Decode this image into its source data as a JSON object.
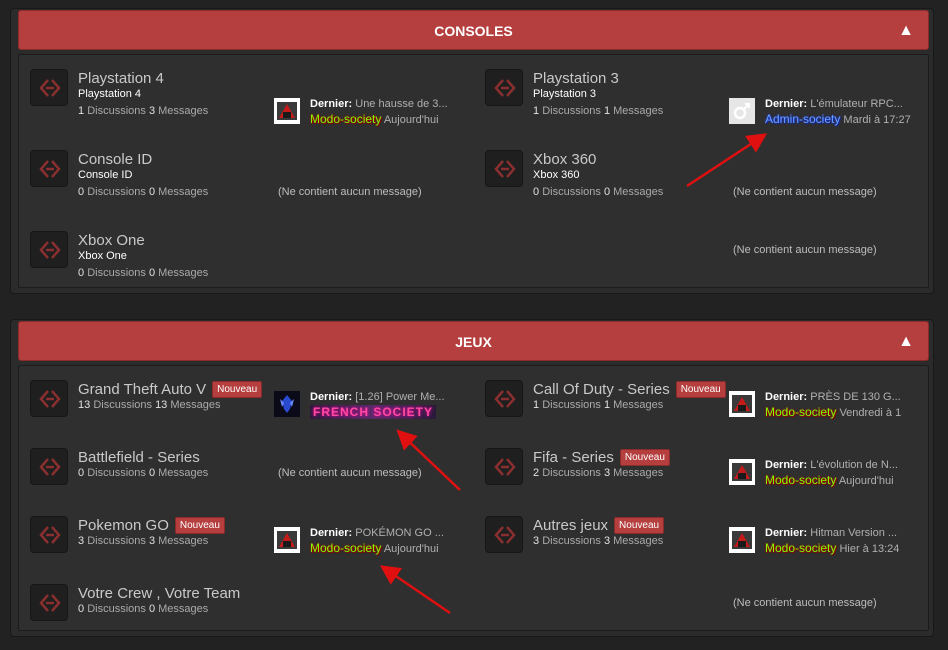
{
  "categories": [
    {
      "title": "CONSOLES",
      "forums": [
        {
          "title": "Playstation 4",
          "subtitle": "Playstation 4",
          "discussions": "1",
          "messages": "3",
          "last": {
            "label": "Dernier:",
            "text": "Une hausse de 3...",
            "user": "Modo-society",
            "date": "Aujourd'hui",
            "usertype": "modo"
          }
        },
        {
          "title": "Playstation 3",
          "subtitle": "Playstation 3",
          "discussions": "1",
          "messages": "1",
          "last": {
            "label": "Dernier:",
            "text": "L'émulateur RPC...",
            "user": "Admin-society",
            "date": "Mardi à 17:27",
            "usertype": "admin"
          }
        },
        {
          "title": "Console ID",
          "subtitle": "Console ID",
          "discussions": "0",
          "messages": "0",
          "empty": "(Ne contient aucun message)"
        },
        {
          "title": "Xbox 360",
          "subtitle": "Xbox 360",
          "discussions": "0",
          "messages": "0",
          "empty": "(Ne contient aucun message)"
        },
        {
          "title": "Xbox One",
          "subtitle": "Xbox One",
          "discussions": "0",
          "messages": "0",
          "empty": "(Ne contient aucun message)"
        }
      ]
    },
    {
      "title": "JEUX",
      "forums": [
        {
          "title": "Grand Theft Auto V",
          "badge": "Nouveau",
          "discussions": "13",
          "messages": "13",
          "last": {
            "label": "Dernier:",
            "text": "[1.26] Power Me...",
            "user": "FRENCH SOCIETY",
            "date": "",
            "usertype": "french"
          }
        },
        {
          "title": "Call Of Duty - Series",
          "badge": "Nouveau",
          "discussions": "1",
          "messages": "1",
          "last": {
            "label": "Dernier:",
            "text": "PRÈS DE 130 G...",
            "user": "Modo-society",
            "date": "Vendredi à 1",
            "usertype": "modo"
          }
        },
        {
          "title": "Battlefield - Series",
          "discussions": "0",
          "messages": "0",
          "empty": "(Ne contient aucun message)"
        },
        {
          "title": "Fifa - Series",
          "badge": "Nouveau",
          "discussions": "2",
          "messages": "3",
          "last": {
            "label": "Dernier:",
            "text": "L'évolution de N...",
            "user": "Modo-society",
            "date": "Aujourd'hui",
            "usertype": "modo"
          }
        },
        {
          "title": "Pokemon GO",
          "badge": "Nouveau",
          "discussions": "3",
          "messages": "3",
          "last": {
            "label": "Dernier:",
            "text": "POKÉMON GO ...",
            "user": "Modo-society",
            "date": "Aujourd'hui",
            "usertype": "modo"
          }
        },
        {
          "title": "Autres jeux",
          "badge": "Nouveau",
          "discussions": "3",
          "messages": "3",
          "last": {
            "label": "Dernier:",
            "text": "Hitman Version ...",
            "user": "Modo-society",
            "date": "Hier à 13:24",
            "usertype": "modo"
          }
        },
        {
          "title": "Votre Crew , Votre Team",
          "discussions": "0",
          "messages": "0",
          "empty": "(Ne contient aucun message)"
        },
        {
          "title": "",
          "empty": "(Ne contient aucun message)"
        }
      ]
    }
  ],
  "labels": {
    "discussions": "Discussions",
    "messages": "Messages"
  },
  "icons": {
    "collapse": "chevron-up-icon",
    "forum": "forum-link-icon",
    "avatar": "user-avatar-icon"
  },
  "colors": {
    "header": "#b53f3f",
    "panel": "#2f2f2f",
    "background": "#222222",
    "annotation": "#e01010"
  }
}
